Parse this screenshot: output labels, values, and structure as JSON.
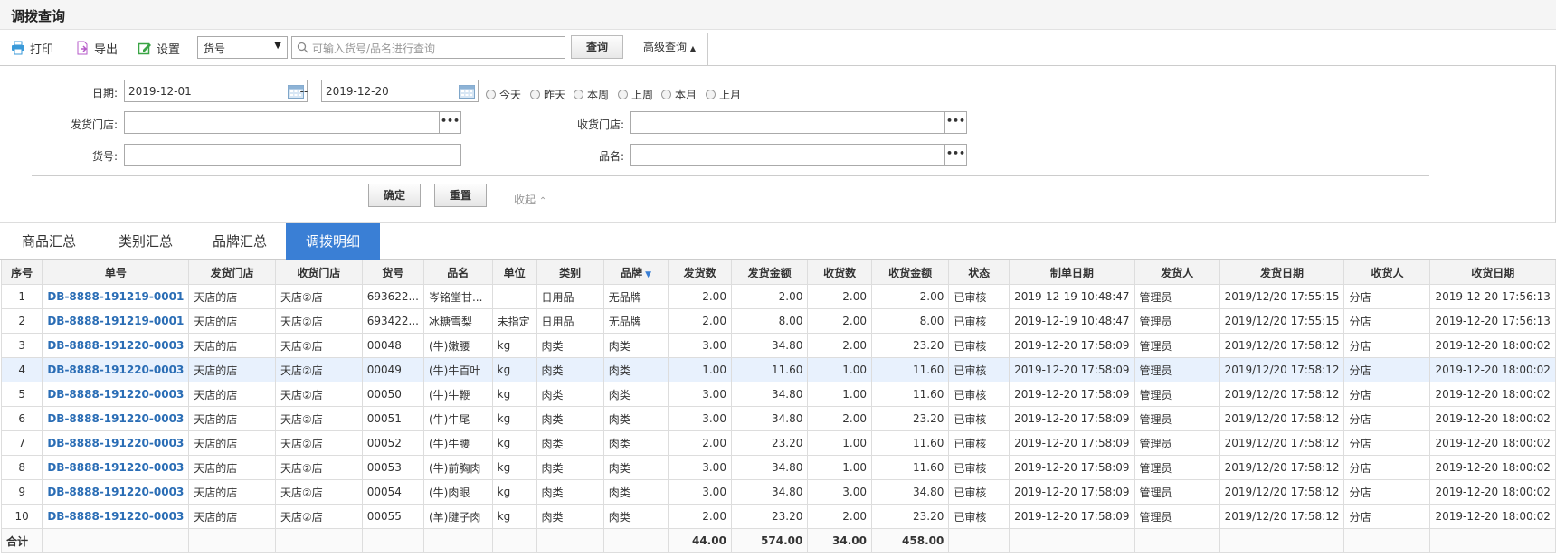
{
  "page": {
    "title": "调拨查询"
  },
  "toolbar": {
    "print": "打印",
    "export": "导出",
    "settings": "设置",
    "field_select": "货号",
    "search_placeholder": "可输入货号/品名进行查询",
    "query": "查询",
    "advanced": "高级查询"
  },
  "advanced": {
    "date_label": "日期:",
    "date_from": "2019-12-01",
    "date_sep": "--",
    "date_to": "2019-12-20",
    "quick_ranges": [
      "今天",
      "昨天",
      "本周",
      "上周",
      "本月",
      "上月"
    ],
    "from_store_label": "发货门店:",
    "to_store_label": "收货门店:",
    "item_no_label": "货号:",
    "item_name_label": "品名:",
    "more": "•••",
    "confirm": "确定",
    "reset": "重置",
    "collapse": "收起"
  },
  "tabs": [
    {
      "label": "商品汇总",
      "active": false
    },
    {
      "label": "类别汇总",
      "active": false
    },
    {
      "label": "品牌汇总",
      "active": false
    },
    {
      "label": "调拨明细",
      "active": true
    }
  ],
  "table": {
    "columns": [
      "序号",
      "单号",
      "发货门店",
      "收货门店",
      "货号",
      "品名",
      "单位",
      "类别",
      "品牌",
      "发货数",
      "发货金额",
      "收货数",
      "收货金额",
      "状态",
      "制单日期",
      "发货人",
      "发货日期",
      "收货人",
      "收货日期"
    ],
    "rows": [
      [
        "1",
        "DB-8888-191219-0001",
        "天店的店",
        "天店②店",
        "693622...",
        "岑铭堂甘...",
        "",
        "日用品",
        "无品牌",
        "2.00",
        "2.00",
        "2.00",
        "2.00",
        "已审核",
        "2019-12-19 10:48:47",
        "管理员",
        "2019/12/20 17:55:15",
        "分店",
        "2019-12-20 17:56:13"
      ],
      [
        "2",
        "DB-8888-191219-0001",
        "天店的店",
        "天店②店",
        "693422...",
        "冰糖雪梨",
        "未指定",
        "日用品",
        "无品牌",
        "2.00",
        "8.00",
        "2.00",
        "8.00",
        "已审核",
        "2019-12-19 10:48:47",
        "管理员",
        "2019/12/20 17:55:15",
        "分店",
        "2019-12-20 17:56:13"
      ],
      [
        "3",
        "DB-8888-191220-0003",
        "天店的店",
        "天店②店",
        "00048",
        "(牛)嫩腰",
        "kg",
        "肉类",
        "肉类",
        "3.00",
        "34.80",
        "2.00",
        "23.20",
        "已审核",
        "2019-12-20 17:58:09",
        "管理员",
        "2019/12/20 17:58:12",
        "分店",
        "2019-12-20 18:00:02"
      ],
      [
        "4",
        "DB-8888-191220-0003",
        "天店的店",
        "天店②店",
        "00049",
        "(牛)牛百叶",
        "kg",
        "肉类",
        "肉类",
        "1.00",
        "11.60",
        "1.00",
        "11.60",
        "已审核",
        "2019-12-20 17:58:09",
        "管理员",
        "2019/12/20 17:58:12",
        "分店",
        "2019-12-20 18:00:02"
      ],
      [
        "5",
        "DB-8888-191220-0003",
        "天店的店",
        "天店②店",
        "00050",
        "(牛)牛鞭",
        "kg",
        "肉类",
        "肉类",
        "3.00",
        "34.80",
        "1.00",
        "11.60",
        "已审核",
        "2019-12-20 17:58:09",
        "管理员",
        "2019/12/20 17:58:12",
        "分店",
        "2019-12-20 18:00:02"
      ],
      [
        "6",
        "DB-8888-191220-0003",
        "天店的店",
        "天店②店",
        "00051",
        "(牛)牛尾",
        "kg",
        "肉类",
        "肉类",
        "3.00",
        "34.80",
        "2.00",
        "23.20",
        "已审核",
        "2019-12-20 17:58:09",
        "管理员",
        "2019/12/20 17:58:12",
        "分店",
        "2019-12-20 18:00:02"
      ],
      [
        "7",
        "DB-8888-191220-0003",
        "天店的店",
        "天店②店",
        "00052",
        "(牛)牛腰",
        "kg",
        "肉类",
        "肉类",
        "2.00",
        "23.20",
        "1.00",
        "11.60",
        "已审核",
        "2019-12-20 17:58:09",
        "管理员",
        "2019/12/20 17:58:12",
        "分店",
        "2019-12-20 18:00:02"
      ],
      [
        "8",
        "DB-8888-191220-0003",
        "天店的店",
        "天店②店",
        "00053",
        "(牛)前胸肉",
        "kg",
        "肉类",
        "肉类",
        "3.00",
        "34.80",
        "1.00",
        "11.60",
        "已审核",
        "2019-12-20 17:58:09",
        "管理员",
        "2019/12/20 17:58:12",
        "分店",
        "2019-12-20 18:00:02"
      ],
      [
        "9",
        "DB-8888-191220-0003",
        "天店的店",
        "天店②店",
        "00054",
        "(牛)肉眼",
        "kg",
        "肉类",
        "肉类",
        "3.00",
        "34.80",
        "3.00",
        "34.80",
        "已审核",
        "2019-12-20 17:58:09",
        "管理员",
        "2019/12/20 17:58:12",
        "分店",
        "2019-12-20 18:00:02"
      ],
      [
        "10",
        "DB-8888-191220-0003",
        "天店的店",
        "天店②店",
        "00055",
        "(羊)腱子肉",
        "kg",
        "肉类",
        "肉类",
        "2.00",
        "23.20",
        "2.00",
        "23.20",
        "已审核",
        "2019-12-20 17:58:09",
        "管理员",
        "2019/12/20 17:58:12",
        "分店",
        "2019-12-20 18:00:02"
      ]
    ],
    "total_label": "合计",
    "totals": {
      "ship_qty": "44.00",
      "ship_amount": "574.00",
      "recv_qty": "34.00",
      "recv_amount": "458.00"
    },
    "highlight_color": "#e8f1fd",
    "link_color": "#2a6db5"
  },
  "colors": {
    "accent": "#3a7fd5"
  }
}
